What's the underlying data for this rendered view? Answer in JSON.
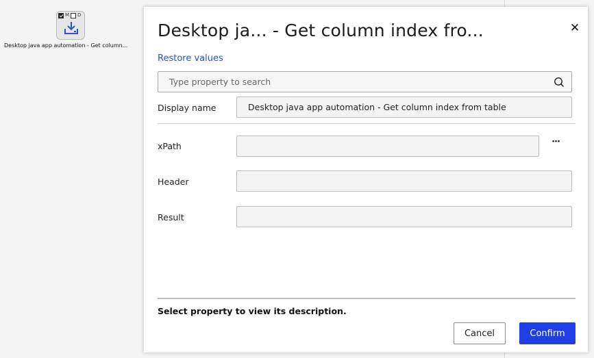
{
  "node": {
    "flag_m": "M",
    "flag_d": "D",
    "icon": "download-to-tray-icon",
    "caption": "Desktop java app automation - Get column..."
  },
  "dialog": {
    "title": "Desktop ja... - Get column index fro...",
    "close_glyph": "✕",
    "restore_label": "Restore values",
    "search_placeholder": "Type property to search",
    "properties": {
      "display_name": {
        "label": "Display name",
        "value": "Desktop java app automation - Get column index from table"
      },
      "xpath": {
        "label": "xPath",
        "value": ""
      },
      "header": {
        "label": "Header",
        "value": ""
      },
      "result": {
        "label": "Result",
        "value": ""
      }
    },
    "ellipsis": "···",
    "description": "Select property to view its description.",
    "cancel_label": "Cancel",
    "confirm_label": "Confirm"
  },
  "colors": {
    "accent": "#1f3fe6",
    "link": "#2a54c7"
  }
}
